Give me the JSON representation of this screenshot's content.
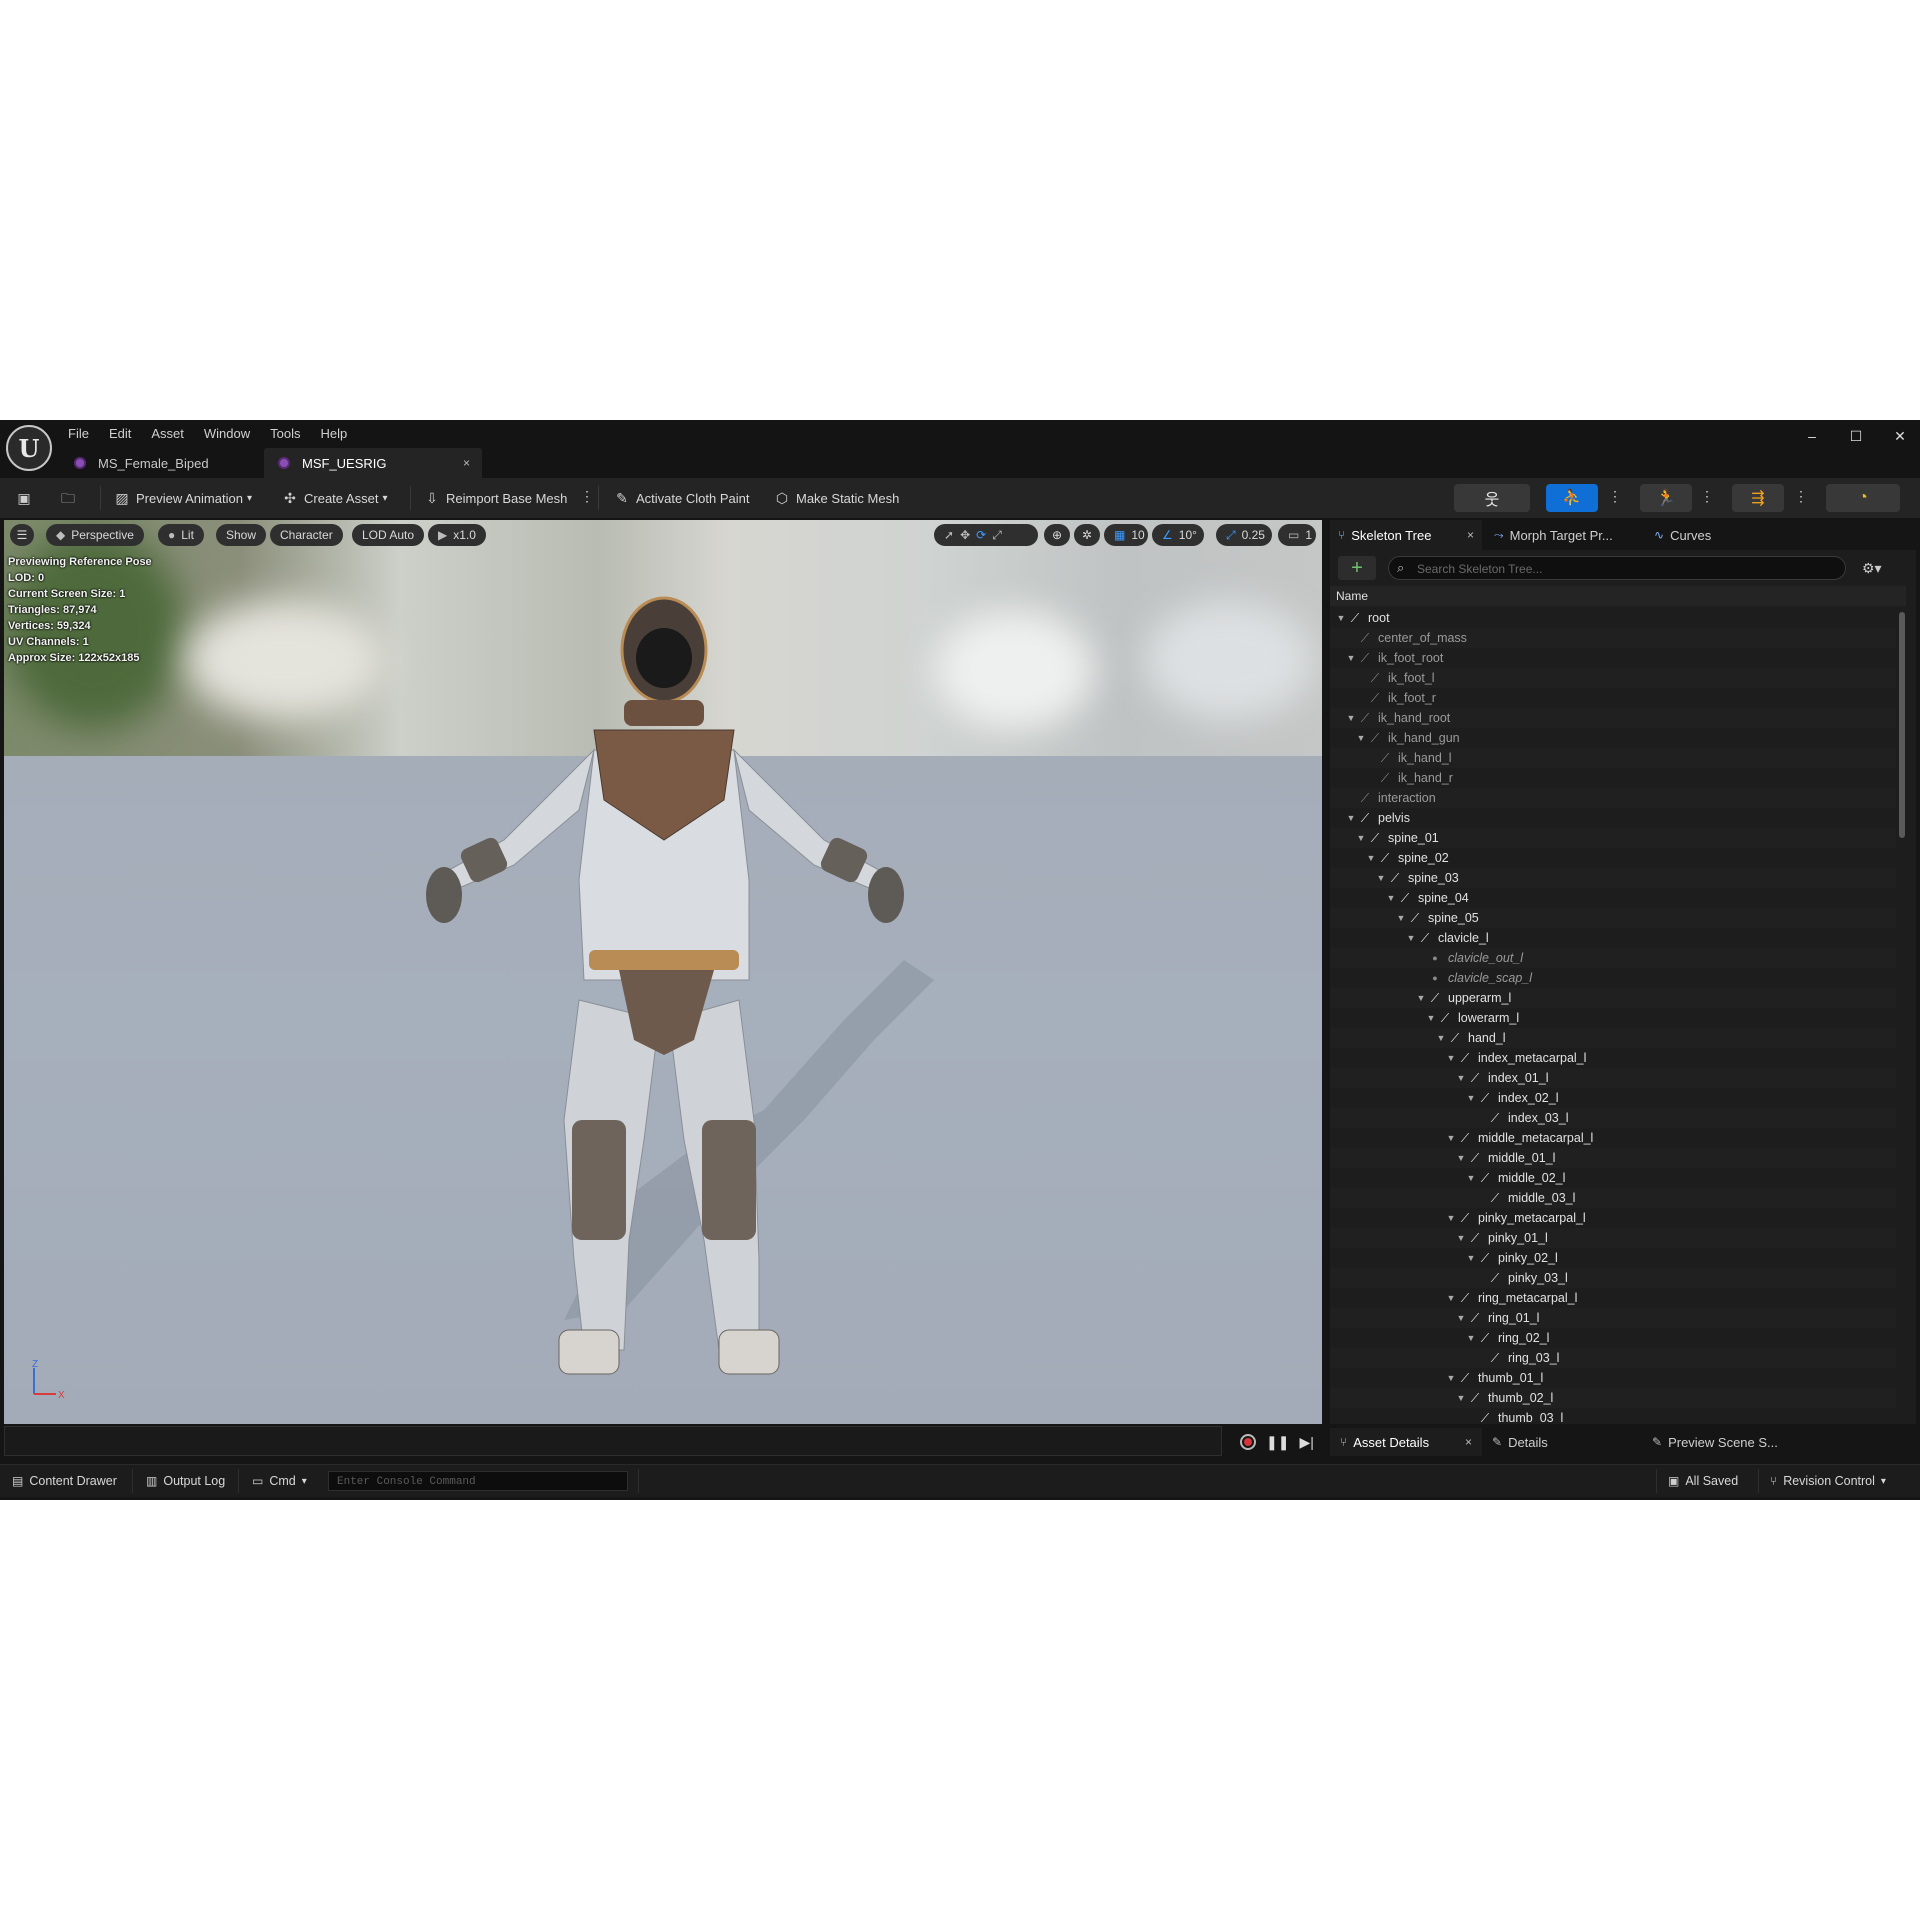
{
  "menu": [
    "File",
    "Edit",
    "Asset",
    "Window",
    "Tools",
    "Help"
  ],
  "doc_tabs": [
    {
      "label": "MS_Female_Biped"
    },
    {
      "label": "MSF_UESRIG",
      "close": "×"
    }
  ],
  "window_controls": {
    "minimize": "–",
    "maximize": "☐",
    "close": "✕"
  },
  "toolbar": {
    "preview_animation": "Preview Animation",
    "create_asset": "Create Asset",
    "reimport": "Reimport Base Mesh",
    "cloth_paint": "Activate Cloth Paint",
    "static_mesh": "Make Static Mesh"
  },
  "viewport": {
    "perspective": "Perspective",
    "lit": "Lit",
    "show": "Show",
    "character": "Character",
    "lod": "LOD Auto",
    "speed": "x1.0",
    "grid_snap": "10",
    "rot_snap": "10°",
    "scale_snap": "0.25",
    "cam_speed": "1",
    "stats": [
      "Previewing Reference Pose",
      "LOD: 0",
      "Current Screen Size: 1",
      "Triangles: 87,974",
      "Vertices: 59,324",
      "UV Channels: 1",
      "Approx Size: 122x52x185"
    ],
    "axis_z": "Z",
    "axis_x": "X"
  },
  "panel": {
    "tabs": [
      {
        "label": "Skeleton Tree",
        "close": "×"
      },
      {
        "label": "Morph Target Pr..."
      },
      {
        "label": "Curves"
      }
    ],
    "search_placeholder": "Search Skeleton Tree...",
    "column": "Name",
    "add": "+",
    "bones": [
      {
        "name": "root",
        "depth": 0,
        "expanded": true,
        "style": "bone"
      },
      {
        "name": "center_of_mass",
        "depth": 1,
        "expanded": false,
        "style": "dim"
      },
      {
        "name": "ik_foot_root",
        "depth": 1,
        "expanded": true,
        "style": "dim"
      },
      {
        "name": "ik_foot_l",
        "depth": 2,
        "expanded": false,
        "style": "dim"
      },
      {
        "name": "ik_foot_r",
        "depth": 2,
        "expanded": false,
        "style": "dim"
      },
      {
        "name": "ik_hand_root",
        "depth": 1,
        "expanded": true,
        "style": "dim"
      },
      {
        "name": "ik_hand_gun",
        "depth": 2,
        "expanded": true,
        "style": "dim"
      },
      {
        "name": "ik_hand_l",
        "depth": 3,
        "expanded": false,
        "style": "dim"
      },
      {
        "name": "ik_hand_r",
        "depth": 3,
        "expanded": false,
        "style": "dim"
      },
      {
        "name": "interaction",
        "depth": 1,
        "expanded": false,
        "style": "dim"
      },
      {
        "name": "pelvis",
        "depth": 1,
        "expanded": true,
        "style": "bone"
      },
      {
        "name": "spine_01",
        "depth": 2,
        "expanded": true,
        "style": "bone"
      },
      {
        "name": "spine_02",
        "depth": 3,
        "expanded": true,
        "style": "bone"
      },
      {
        "name": "spine_03",
        "depth": 4,
        "expanded": true,
        "style": "bone"
      },
      {
        "name": "spine_04",
        "depth": 5,
        "expanded": true,
        "style": "bone"
      },
      {
        "name": "spine_05",
        "depth": 6,
        "expanded": true,
        "style": "bone"
      },
      {
        "name": "clavicle_l",
        "depth": 7,
        "expanded": true,
        "style": "bone"
      },
      {
        "name": "clavicle_out_l",
        "depth": 8,
        "expanded": false,
        "style": "socket"
      },
      {
        "name": "clavicle_scap_l",
        "depth": 8,
        "expanded": false,
        "style": "socket"
      },
      {
        "name": "upperarm_l",
        "depth": 8,
        "expanded": true,
        "style": "bone"
      },
      {
        "name": "lowerarm_l",
        "depth": 9,
        "expanded": true,
        "style": "bone"
      },
      {
        "name": "hand_l",
        "depth": 10,
        "expanded": true,
        "style": "bone"
      },
      {
        "name": "index_metacarpal_l",
        "depth": 11,
        "expanded": true,
        "style": "bone"
      },
      {
        "name": "index_01_l",
        "depth": 12,
        "expanded": true,
        "style": "bone"
      },
      {
        "name": "index_02_l",
        "depth": 13,
        "expanded": true,
        "style": "bone"
      },
      {
        "name": "index_03_l",
        "depth": 14,
        "expanded": false,
        "style": "bone"
      },
      {
        "name": "middle_metacarpal_l",
        "depth": 11,
        "expanded": true,
        "style": "bone"
      },
      {
        "name": "middle_01_l",
        "depth": 12,
        "expanded": true,
        "style": "bone"
      },
      {
        "name": "middle_02_l",
        "depth": 13,
        "expanded": true,
        "style": "bone"
      },
      {
        "name": "middle_03_l",
        "depth": 14,
        "expanded": false,
        "style": "bone"
      },
      {
        "name": "pinky_metacarpal_l",
        "depth": 11,
        "expanded": true,
        "style": "bone"
      },
      {
        "name": "pinky_01_l",
        "depth": 12,
        "expanded": true,
        "style": "bone"
      },
      {
        "name": "pinky_02_l",
        "depth": 13,
        "expanded": true,
        "style": "bone"
      },
      {
        "name": "pinky_03_l",
        "depth": 14,
        "expanded": false,
        "style": "bone"
      },
      {
        "name": "ring_metacarpal_l",
        "depth": 11,
        "expanded": true,
        "style": "bone"
      },
      {
        "name": "ring_01_l",
        "depth": 12,
        "expanded": true,
        "style": "bone"
      },
      {
        "name": "ring_02_l",
        "depth": 13,
        "expanded": true,
        "style": "bone"
      },
      {
        "name": "ring_03_l",
        "depth": 14,
        "expanded": false,
        "style": "bone"
      },
      {
        "name": "thumb_01_l",
        "depth": 11,
        "expanded": true,
        "style": "bone"
      },
      {
        "name": "thumb_02_l",
        "depth": 12,
        "expanded": true,
        "style": "bone"
      },
      {
        "name": "thumb_03_l",
        "depth": 13,
        "expanded": false,
        "style": "bone"
      }
    ]
  },
  "bottom_tabs": [
    {
      "label": "Asset Details",
      "close": "×"
    },
    {
      "label": "Details"
    },
    {
      "label": "Preview Scene S..."
    }
  ],
  "statusbar": {
    "content_drawer": "Content Drawer",
    "output_log": "Output Log",
    "cmd": "Cmd",
    "console_placeholder": "Enter Console Command",
    "all_saved": "All Saved",
    "revision_control": "Revision Control"
  },
  "colors": {
    "accent": "#0f6fd6",
    "record": "#d8343b",
    "add": "#6fc26f"
  }
}
